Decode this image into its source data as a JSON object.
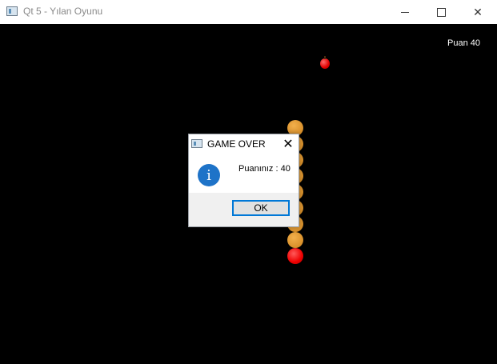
{
  "window": {
    "title": "Qt 5 - Yılan Oyunu",
    "controls": [
      "minimize",
      "maximize",
      "close"
    ]
  },
  "game": {
    "score_text": "Puan 40",
    "snake_length_segments": 9,
    "colors": {
      "background": "#000000",
      "snake_body": "#d9902a",
      "snake_head": "#ee0000",
      "apple": "#e00000"
    }
  },
  "dialog": {
    "title": "GAME OVER",
    "message": "Puanınız : 40",
    "ok_label": "OK",
    "close_glyph": "✕",
    "info_glyph": "i"
  },
  "icons": {
    "app": "app-window-icon",
    "info": "info-icon"
  }
}
